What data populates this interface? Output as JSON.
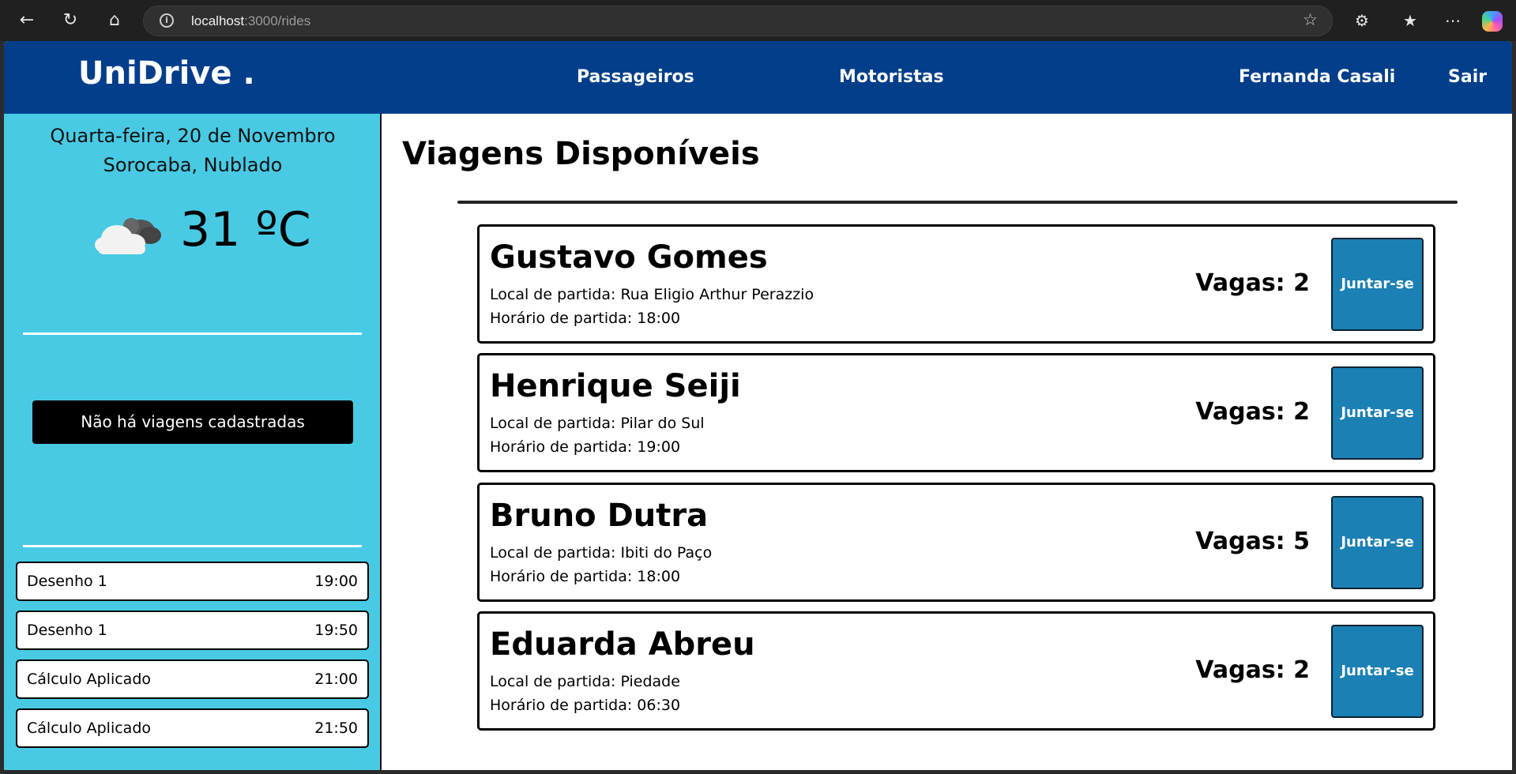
{
  "browser": {
    "url_host": "localhost",
    "url_path": ":3000/rides"
  },
  "header": {
    "logo": "UniDrive .",
    "nav": {
      "passengers": "Passageiros",
      "drivers": "Motoristas"
    },
    "user_name": "Fernanda Casali",
    "logout": "Sair"
  },
  "sidebar": {
    "date": "Quarta-feira, 20 de Novembro",
    "location": "Sorocaba, Nublado",
    "temperature": "31 ºC",
    "weather_icon": "cloud-icon",
    "empty_rides": "Não há viagens cadastradas",
    "classes": [
      {
        "name": "Desenho 1",
        "time": "19:00"
      },
      {
        "name": "Desenho 1",
        "time": "19:50"
      },
      {
        "name": "Cálculo Aplicado",
        "time": "21:00"
      },
      {
        "name": "Cálculo Aplicado",
        "time": "21:50"
      }
    ]
  },
  "main": {
    "title": "Viagens Disponíveis",
    "rides": [
      {
        "driver": "Gustavo Gomes",
        "departure": "Local de partida: Rua Eligio Arthur Perazzio",
        "time": "Horário de partida: 18:00",
        "seats": "Vagas: 2",
        "join": "Juntar-se"
      },
      {
        "driver": "Henrique Seiji",
        "departure": "Local de partida: Pilar do Sul",
        "time": "Horário de partida: 19:00",
        "seats": "Vagas: 2",
        "join": "Juntar-se"
      },
      {
        "driver": "Bruno Dutra",
        "departure": "Local de partida: Ibiti do Paço",
        "time": "Horário de partida: 18:00",
        "seats": "Vagas: 5",
        "join": "Juntar-se"
      },
      {
        "driver": "Eduarda Abreu",
        "departure": "Local de partida: Piedade",
        "time": "Horário de partida: 06:30",
        "seats": "Vagas: 2",
        "join": "Juntar-se"
      }
    ]
  }
}
